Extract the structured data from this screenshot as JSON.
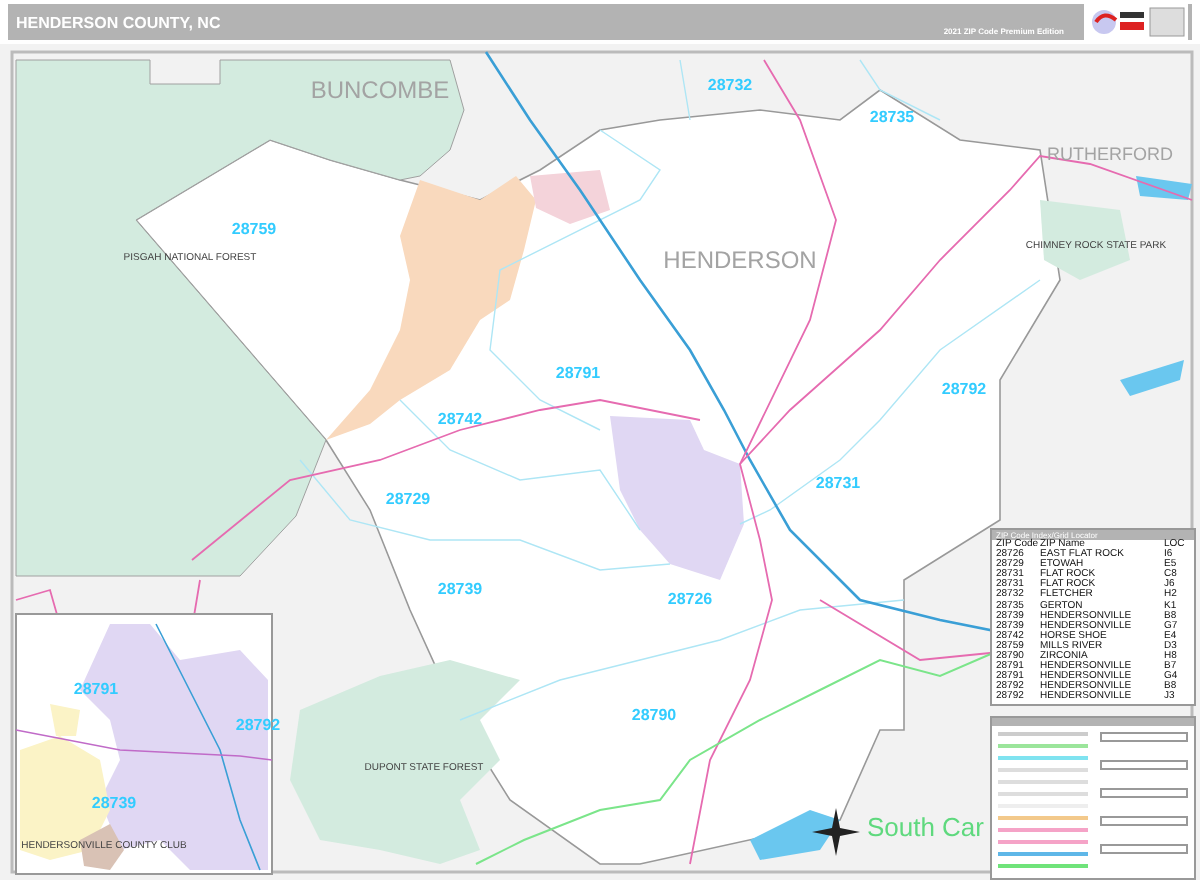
{
  "header": {
    "title": "HENDERSON COUNTY, NC",
    "edition": "2021 ZIP Code Premium Edition"
  },
  "map": {
    "county_labels": [
      "BUNCOMBE",
      "HENDERSON",
      "RUTHERFORD"
    ],
    "zip_labels": [
      "28732",
      "28735",
      "28759",
      "28791",
      "28792",
      "28742",
      "28729",
      "28731",
      "28739",
      "28726",
      "28790"
    ],
    "area_labels": [
      "PISGAH NATIONAL FOREST",
      "DUPONT STATE FOREST",
      "CHIMNEY ROCK STATE PARK"
    ],
    "state_label": "South Car"
  },
  "inset": {
    "zip_labels": [
      "28791",
      "28792",
      "28739"
    ],
    "area_label": "HENDERSONVILLE COUNTY CLUB"
  },
  "zip_table": {
    "title": "ZIP Code Index/Grid Locator",
    "columns": [
      "ZIP Code",
      "ZIP Name",
      "LOC"
    ],
    "rows": [
      [
        "28726",
        "EAST FLAT ROCK",
        "I6"
      ],
      [
        "28729",
        "ETOWAH",
        "E5"
      ],
      [
        "28731",
        "FLAT ROCK",
        "C8"
      ],
      [
        "28731",
        "FLAT ROCK",
        "J6"
      ],
      [
        "28732",
        "FLETCHER",
        "H2"
      ],
      [
        "28735",
        "GERTON",
        "K1"
      ],
      [
        "28739",
        "HENDERSONVILLE",
        "B8"
      ],
      [
        "28739",
        "HENDERSONVILLE",
        "G7"
      ],
      [
        "28742",
        "HORSE SHOE",
        "E4"
      ],
      [
        "28759",
        "MILLS RIVER",
        "D3"
      ],
      [
        "28790",
        "ZIRCONIA",
        "H8"
      ],
      [
        "28791",
        "HENDERSONVILLE",
        "B7"
      ],
      [
        "28791",
        "HENDERSONVILLE",
        "G4"
      ],
      [
        "28792",
        "HENDERSONVILLE",
        "B8"
      ],
      [
        "28792",
        "HENDERSONVILLE",
        "J3"
      ]
    ]
  }
}
